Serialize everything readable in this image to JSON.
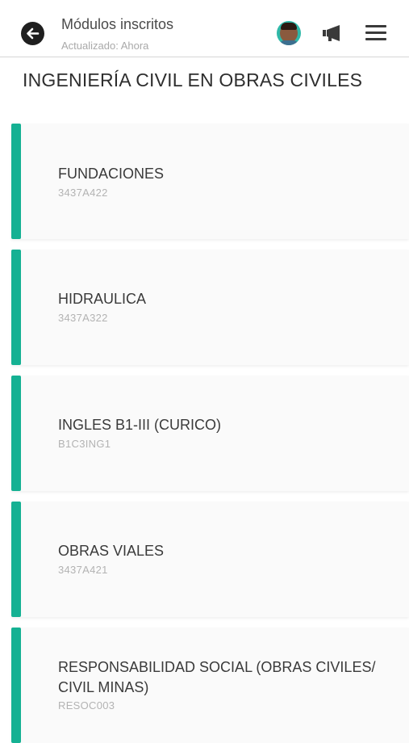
{
  "header": {
    "title": "Módulos inscritos",
    "subtitle": "Actualizado: Ahora"
  },
  "icons": {
    "back": "back-arrow-icon",
    "avatar": "user-avatar",
    "megaphone": "megaphone-icon",
    "menu": "hamburger-menu-icon"
  },
  "career": "INGENIERÍA CIVIL EN OBRAS CIVILES",
  "modules": [
    {
      "name": "FUNDACIONES",
      "code": "3437A422"
    },
    {
      "name": "HIDRAULICA",
      "code": "3437A322"
    },
    {
      "name": "INGLES B1-III (CURICO)",
      "code": "B1C3ING1"
    },
    {
      "name": "OBRAS VIALES",
      "code": "3437A421"
    },
    {
      "name": "RESPONSABILIDAD SOCIAL (OBRAS CIVILES/ CIVIL MINAS)",
      "code": "RESOC003"
    }
  ],
  "colors": {
    "accent": "#15b193",
    "avatar_ring": "#2fb8a8"
  }
}
